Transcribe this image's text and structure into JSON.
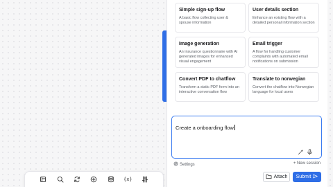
{
  "templates": [
    {
      "title": "Simple sign-up flow",
      "description": "A basic flow collecting user & spouse information"
    },
    {
      "title": "User details section",
      "description": "Enhance an existing flow with a detailed personal information section"
    },
    {
      "title": "Image generation",
      "description": "An insurance questionnaire with AI generated images for enhanced visual engagement"
    },
    {
      "title": "Email trigger",
      "description": "A flow for handling customer complaints with automated email notifications on submission"
    },
    {
      "title": "Convert PDF to chatflow",
      "description": "Transform a static PDF form into an interactive conversation flow"
    },
    {
      "title": "Translate to norwegian",
      "description": "Convert the chatflow into Norwegian language for local users"
    }
  ],
  "prompt": {
    "value": "Create a onboarding flow"
  },
  "footer": {
    "settings_label": "Settings",
    "new_session_label": "+ New session"
  },
  "buttons": {
    "attach_label": "Attach",
    "submit_label": "Submit"
  },
  "toolbar": {
    "variables_label": "{x}"
  },
  "colors": {
    "accent": "#2f6ee6",
    "border_focus": "#3a7bf0"
  }
}
